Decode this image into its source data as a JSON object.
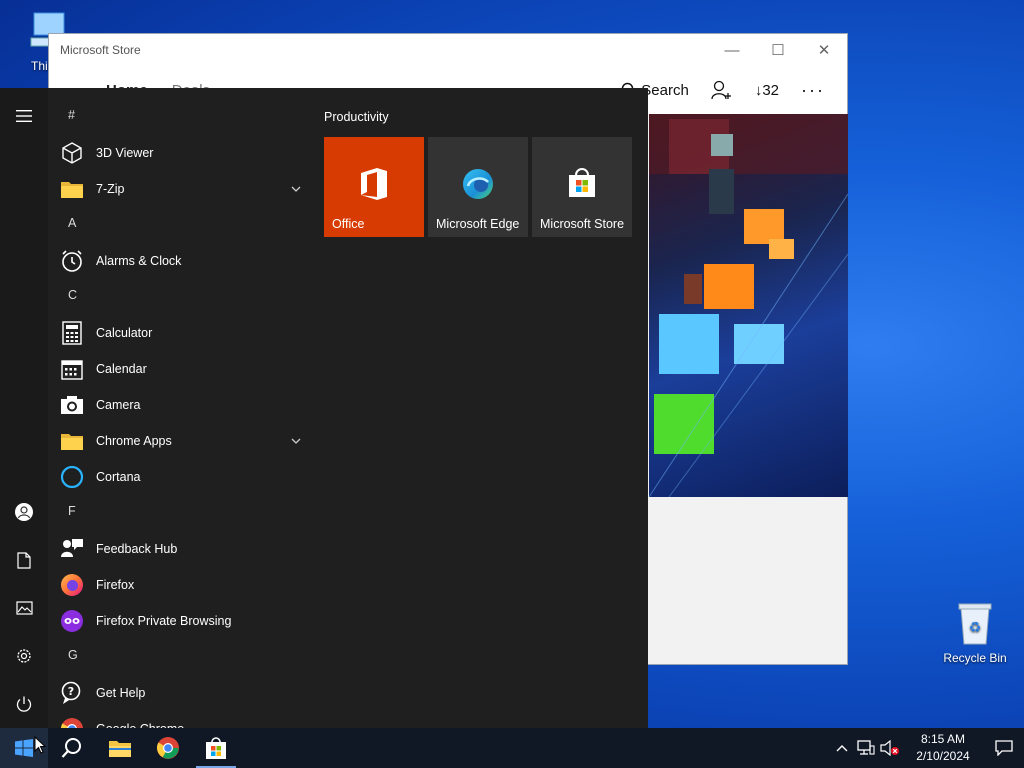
{
  "desktop": {
    "this_pc_label": "This P",
    "recycle_label": "Recycle Bin"
  },
  "store": {
    "title": "Microsoft Store",
    "nav": [
      "Home",
      "Deals"
    ],
    "search_label": "Search",
    "downloads_count": "32"
  },
  "start": {
    "tiles_group_title": "Productivity",
    "tiles": [
      {
        "label": "Office",
        "color": "#d83b01"
      },
      {
        "label": "Microsoft Edge",
        "color": "#333333"
      },
      {
        "label": "Microsoft Store",
        "color": "#333333"
      }
    ],
    "apps": [
      {
        "type": "header",
        "label": "#"
      },
      {
        "type": "app",
        "label": "3D Viewer",
        "icon": "cube-icon"
      },
      {
        "type": "app",
        "label": "7-Zip",
        "icon": "folder-icon",
        "expandable": true
      },
      {
        "type": "header",
        "label": "A"
      },
      {
        "type": "app",
        "label": "Alarms & Clock",
        "icon": "clock-icon"
      },
      {
        "type": "header",
        "label": "C"
      },
      {
        "type": "app",
        "label": "Calculator",
        "icon": "calculator-icon"
      },
      {
        "type": "app",
        "label": "Calendar",
        "icon": "calendar-icon"
      },
      {
        "type": "app",
        "label": "Camera",
        "icon": "camera-icon"
      },
      {
        "type": "app",
        "label": "Chrome Apps",
        "icon": "folder-icon",
        "expandable": true
      },
      {
        "type": "app",
        "label": "Cortana",
        "icon": "cortana-icon"
      },
      {
        "type": "header",
        "label": "F"
      },
      {
        "type": "app",
        "label": "Feedback Hub",
        "icon": "feedback-icon"
      },
      {
        "type": "app",
        "label": "Firefox",
        "icon": "firefox-icon"
      },
      {
        "type": "app",
        "label": "Firefox Private Browsing",
        "icon": "firefox-private-icon"
      },
      {
        "type": "header",
        "label": "G"
      },
      {
        "type": "app",
        "label": "Get Help",
        "icon": "help-icon"
      },
      {
        "type": "app",
        "label": "Google Chrome",
        "icon": "chrome-icon"
      }
    ]
  },
  "taskbar": {
    "time": "8:15 AM",
    "date": "2/10/2024"
  }
}
